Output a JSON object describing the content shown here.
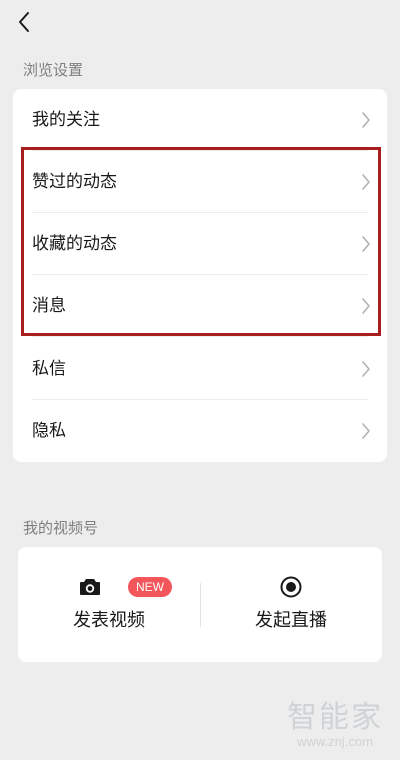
{
  "browse_section": {
    "title": "浏览设置",
    "items": [
      {
        "label": "我的关注"
      },
      {
        "label": "赞过的动态"
      },
      {
        "label": "收藏的动态"
      },
      {
        "label": "消息"
      },
      {
        "label": "私信"
      },
      {
        "label": "隐私"
      }
    ]
  },
  "channel_section": {
    "title": "我的视频号",
    "post_video": {
      "label": "发表视频",
      "badge": "NEW",
      "icon": "camera-icon"
    },
    "go_live": {
      "label": "发起直播",
      "icon": "live-record-icon"
    }
  },
  "watermark": {
    "title": "智能家",
    "url": "www.znj.com"
  },
  "colors": {
    "background": "#ededed",
    "card": "#ffffff",
    "highlight_border": "#a81e1e",
    "badge": "#f2565a",
    "secondary_text": "#7f7f7f"
  }
}
